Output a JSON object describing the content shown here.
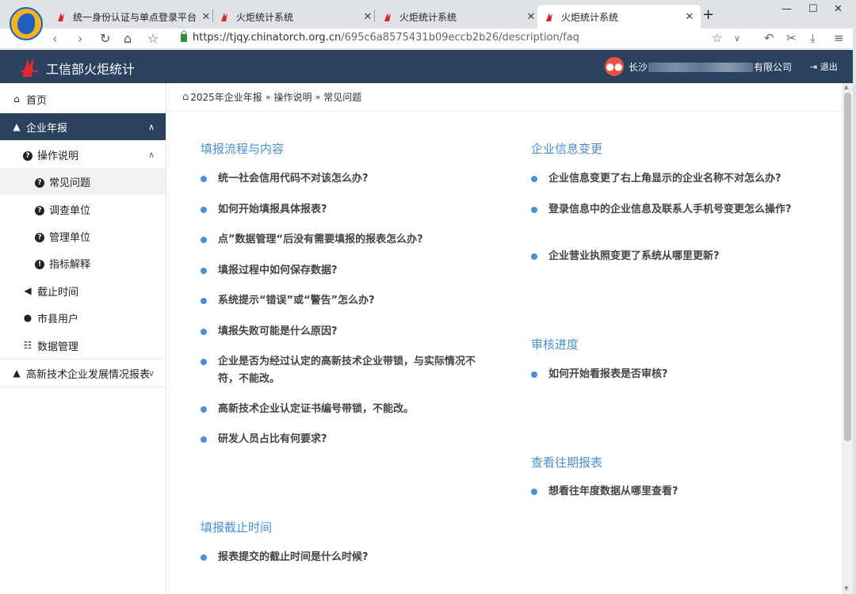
{
  "browser": {
    "tabs": [
      {
        "title": "统一身份认证与单点登录平台",
        "close": "✕"
      },
      {
        "title": "火炬统计系统",
        "close": "✕"
      },
      {
        "title": "火炬统计系统",
        "close": "✕"
      },
      {
        "title": "火炬统计系统",
        "close": "✕"
      }
    ],
    "new_tab": "+",
    "window_controls": {
      "minimize": "—",
      "maximize": "☐",
      "close": "✕"
    },
    "url_host": "https://tjqy.chinatorch.org.cn",
    "url_path": "/695c6a8575431b09eccb2b26/description/faq"
  },
  "header": {
    "title": "工信部火炬统计",
    "company_prefix": "长沙",
    "company_suffix": "有限公司",
    "logout": "退出"
  },
  "sidebar": {
    "home": "首页",
    "annual_report": "企业年报",
    "instructions": "操作说明",
    "faq": "常见问题",
    "survey_unit": "调查单位",
    "admin_unit": "管理单位",
    "indicator": "指标解释",
    "deadline": "截止时间",
    "city_users": "市县用户",
    "data_mgmt": "数据管理",
    "hitech_report": "高新技术企业发展情况报表"
  },
  "breadcrumb": {
    "items": [
      "2025年企业年报",
      "操作说明",
      "常见问题"
    ]
  },
  "sections": {
    "fill_process": {
      "title": "填报流程与内容",
      "items": [
        "统一社会信用代码不对该怎么办?",
        "如何开始填报具体报表?",
        "点”数据管理“后没有需要填报的报表怎么办?",
        "填报过程中如何保存数据?",
        "系统提示“错误”或“警告”怎么办?",
        "填报失败可能是什么原因?",
        "企业是否为经过认定的高新技术企业带锁，与实际情况不符，不能改。",
        "高新技术企业认定证书编号带锁，不能改。",
        "研发人员占比有何要求?"
      ]
    },
    "deadline": {
      "title": "填报截止时间",
      "items": [
        "报表提交的截止时间是什么时候?"
      ]
    },
    "info_change": {
      "title": "企业信息变更",
      "items": [
        "企业信息变更了右上角显示的企业名称不对怎么办?",
        "登录信息中的企业信息及联系人手机号变更怎么操作?",
        "企业营业执照变更了系统从哪里更新?"
      ]
    },
    "review": {
      "title": "审核进度",
      "items": [
        "如何开始看报表是否审核?"
      ]
    },
    "history": {
      "title": "查看往期报表",
      "items": [
        "想看往年度数据从哪里查看?"
      ]
    }
  }
}
